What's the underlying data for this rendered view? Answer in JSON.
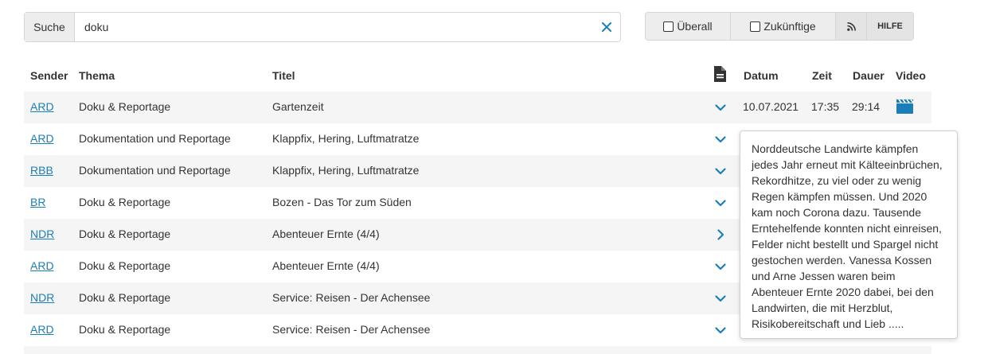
{
  "search": {
    "label": "Suche",
    "value": "doku",
    "clear_icon": "close-icon"
  },
  "toolbar": {
    "everywhere_label": "Überall",
    "future_label": "Zukünftige",
    "rss_icon": "rss-icon",
    "help_label": "HILFE"
  },
  "table": {
    "headers": {
      "sender": "Sender",
      "thema": "Thema",
      "titel": "Titel",
      "description_icon": "document-icon",
      "datum": "Datum",
      "zeit": "Zeit",
      "dauer": "Dauer",
      "video": "Video"
    },
    "rows": [
      {
        "sender": "ARD",
        "thema": "Doku & Reportage",
        "titel": "Gartenzeit",
        "datum": "10.07.2021",
        "zeit": "17:35",
        "dauer": "29:14",
        "chevron": "chevron-down-icon",
        "video": "video-clapperboard-icon"
      },
      {
        "sender": "ARD",
        "thema": "Dokumentation und Reportage",
        "titel": "Klappfix, Hering, Luftmatratze",
        "chevron": "chevron-down-icon"
      },
      {
        "sender": "RBB",
        "thema": "Dokumentation und Reportage",
        "titel": "Klappfix, Hering, Luftmatratze",
        "chevron": "chevron-down-icon"
      },
      {
        "sender": "BR",
        "thema": "Doku & Reportage",
        "titel": "Bozen - Das Tor zum Süden",
        "chevron": "chevron-down-icon"
      },
      {
        "sender": "NDR",
        "thema": "Doku & Reportage",
        "titel": "Abenteuer Ernte (4/4)",
        "chevron": "chevron-right-icon"
      },
      {
        "sender": "ARD",
        "thema": "Doku & Reportage",
        "titel": "Abenteuer Ernte (4/4)",
        "chevron": "chevron-down-icon"
      },
      {
        "sender": "NDR",
        "thema": "Doku & Reportage",
        "titel": "Service: Reisen - Der Achensee",
        "chevron": "chevron-down-icon"
      },
      {
        "sender": "ARD",
        "thema": "Doku & Reportage",
        "titel": "Service: Reisen - Der Achensee",
        "chevron": "chevron-down-icon"
      }
    ]
  },
  "tooltip": {
    "lines": [
      "Norddeutsche Landwirte kämpfen",
      "jedes Jahr erneut mit Kälteeinbrüchen,",
      "Rekordhitze, zu viel oder zu wenig",
      "Regen kämpfen müssen. Und 2020",
      "kam noch Corona dazu. Tausende",
      "Erntehelfende konnten nicht einreisen,",
      "Felder nicht bestellt und Spargel nicht",
      "gestochen werden. Vanessa Kossen",
      "und Arne Jessen waren beim",
      "Abenteuer Ernte 2020 dabei, bei den",
      "Landwirten, die mit Herzblut,",
      "Risikobereitschaft und Lieb ....."
    ]
  },
  "colors": {
    "link": "#1a7fb8",
    "accent_icon": "#1a7fb8",
    "row_stripe": "#f5f5f5"
  }
}
